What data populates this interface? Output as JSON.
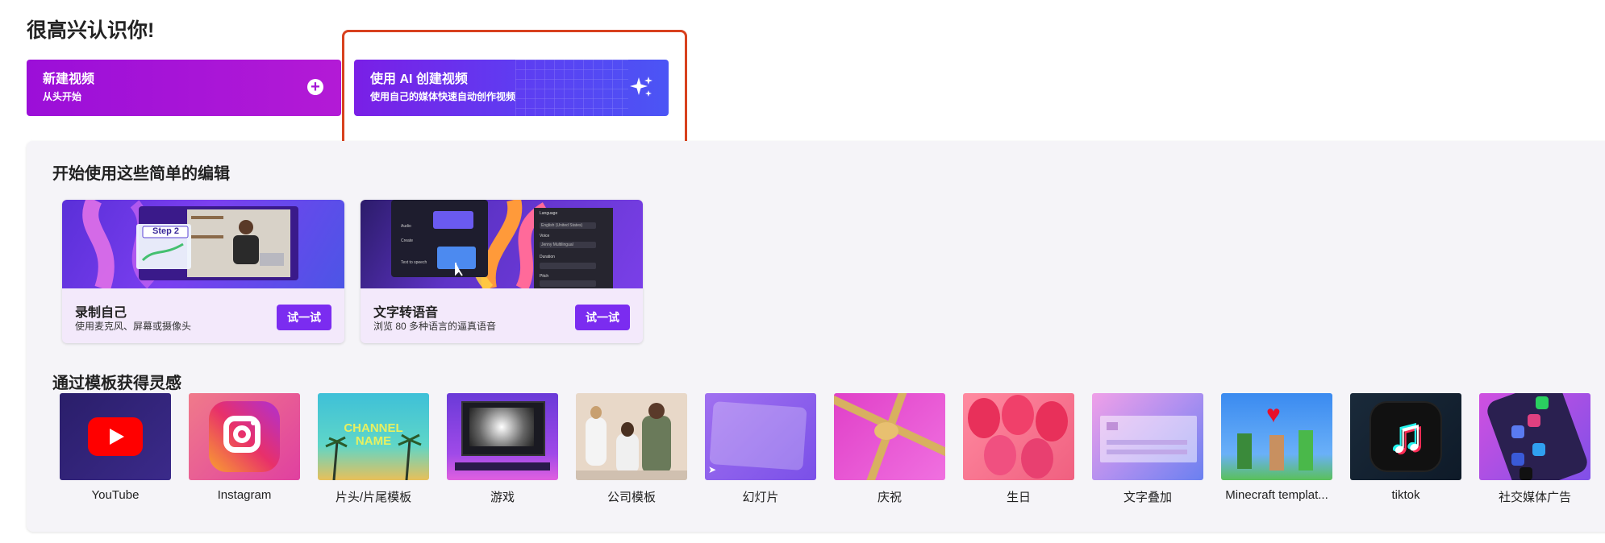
{
  "greeting": "很高兴认识你!",
  "cta": {
    "new_video": {
      "title": "新建视频",
      "subtitle": "从头开始",
      "icon": "plus-circle-icon"
    },
    "ai_video": {
      "title": "使用 AI 创建视频",
      "subtitle": "使用自己的媒体快速自动创作视频",
      "icon": "sparkle-icon"
    }
  },
  "edits": {
    "title": "开始使用这些简单的编辑",
    "cards": [
      {
        "title": "录制自己",
        "desc": "使用麦克风、屏幕或摄像头",
        "button": "试一试",
        "thumb_text": "Step 2"
      },
      {
        "title": "文字转语音",
        "desc": "浏览 80 多种语言的逼真语音",
        "button": "试一试",
        "panel_labels": [
          "Language",
          "English (United States)",
          "Voice",
          "Jenny Multilingual",
          "Duration",
          "Pitch",
          "Audio",
          "Create",
          "Text to speech"
        ]
      }
    ]
  },
  "templates": {
    "title": "通过模板获得灵感",
    "items": [
      {
        "label": "YouTube"
      },
      {
        "label": "Instagram"
      },
      {
        "label": "片头/片尾模板",
        "thumb_text": "CHANNEL NAME"
      },
      {
        "label": "游戏"
      },
      {
        "label": "公司模板"
      },
      {
        "label": "幻灯片"
      },
      {
        "label": "庆祝"
      },
      {
        "label": "生日"
      },
      {
        "label": "文字叠加"
      },
      {
        "label": "Minecraft templat..."
      },
      {
        "label": "tiktok"
      },
      {
        "label": "社交媒体广告"
      }
    ]
  },
  "colors": {
    "accent": "#7b2cf0",
    "highlight_border": "#d8411e",
    "panel_bg": "#f5f4f8"
  }
}
